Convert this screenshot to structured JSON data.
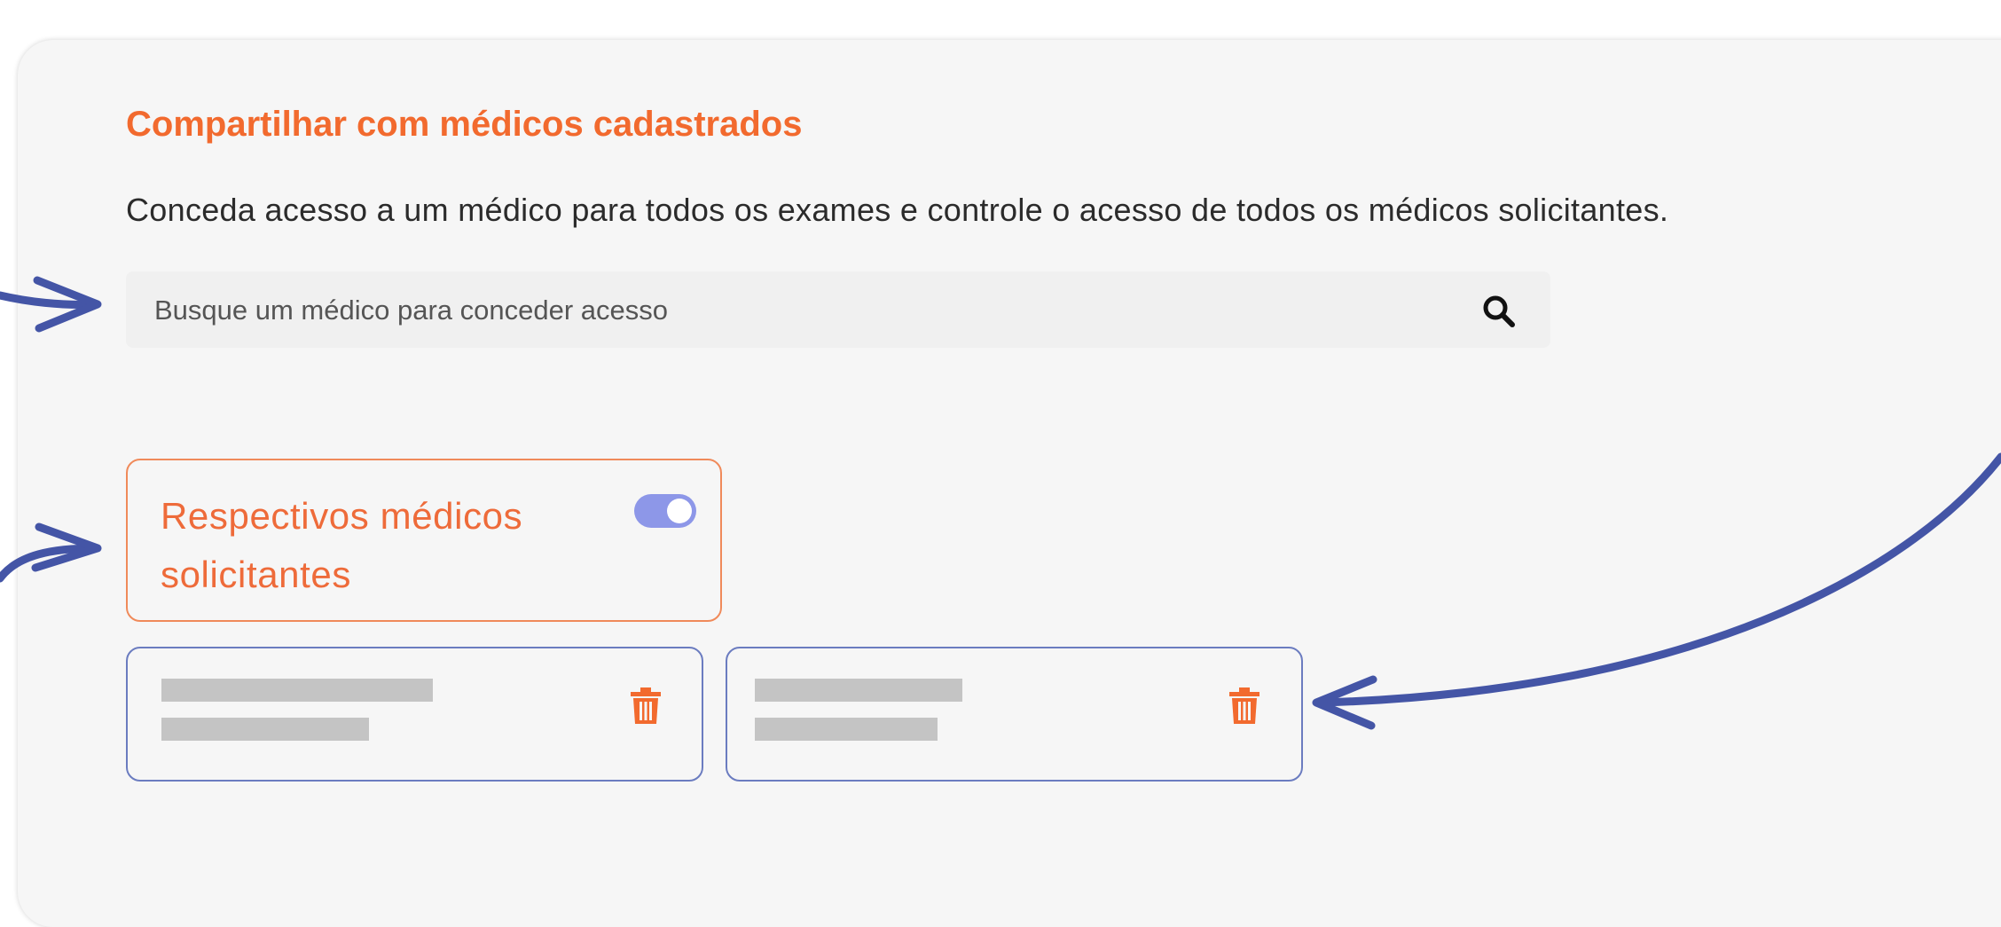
{
  "section": {
    "title": "Compartilhar com médicos cadastrados",
    "description": "Conceda acesso a um médico para todos os exames e controle o acesso de todos os médicos solicitantes."
  },
  "search": {
    "placeholder": "Busque um médico para conceder acesso",
    "value": "",
    "icon": "search-icon"
  },
  "requesting_doctors_toggle": {
    "label": "Respectivos médicos solicitantes",
    "enabled": true
  },
  "doctors": [
    {
      "name": "",
      "detail": "",
      "delete_icon": "trash-icon"
    },
    {
      "name": "",
      "detail": "",
      "delete_icon": "trash-icon"
    }
  ],
  "colors": {
    "accent_orange": "#f26a2e",
    "toggle_on": "#8d97e8",
    "doctor_card_border": "#6b7cc0",
    "annotation_arrow": "#4455a6"
  }
}
